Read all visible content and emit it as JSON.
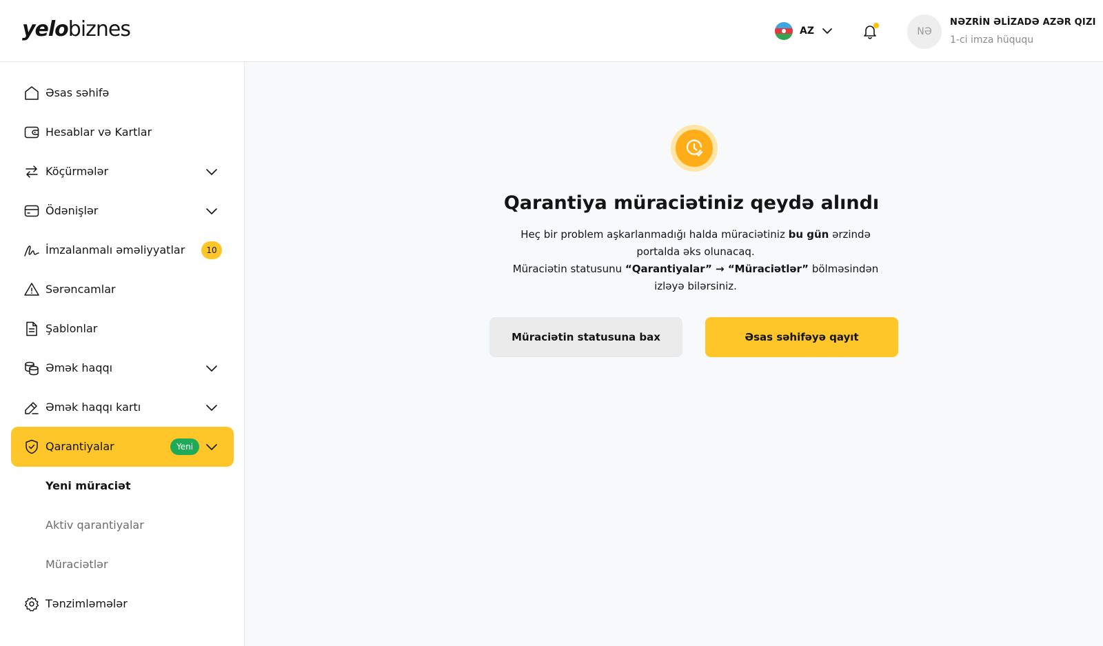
{
  "header": {
    "logo_bold": "yelo",
    "logo_light": "biznes",
    "language_code": "AZ",
    "user_initials": "NƏ",
    "user_name": "NƏZRİN ƏLİZADƏ AZƏR QIZI",
    "user_role": "1-ci imza hüququ"
  },
  "sidebar": {
    "items": [
      {
        "label": "Əsas səhifə",
        "icon": "home-icon"
      },
      {
        "label": "Hesablar və Kartlar",
        "icon": "wallet-icon"
      },
      {
        "label": "Köçürmələr",
        "icon": "transfer-icon",
        "expandable": true
      },
      {
        "label": "Ödənişlər",
        "icon": "card-icon",
        "expandable": true
      },
      {
        "label": "İmzalanmalı əməliyyatlar",
        "icon": "signature-icon",
        "badge": "10"
      },
      {
        "label": "Sərəncamlar",
        "icon": "warning-icon"
      },
      {
        "label": "Şablonlar",
        "icon": "document-icon"
      },
      {
        "label": "Əmək haqqı",
        "icon": "coins-icon",
        "expandable": true
      },
      {
        "label": "Əmək haqqı kartı",
        "icon": "edit-card-icon",
        "expandable": true
      },
      {
        "label": "Qarantiyalar",
        "icon": "shield-check-icon",
        "expandable": true,
        "active": true,
        "badge": "Yeni"
      },
      {
        "label": "Tənzimləmələr",
        "icon": "gear-icon"
      }
    ],
    "guarantee_subitems": [
      "Yeni müraciət",
      "Aktiv qarantiyalar",
      "Müraciətlər"
    ]
  },
  "main": {
    "title": "Qarantiya müraciətiniz qeydə alındı",
    "desc_part1": "Heç bir problem aşkarlanmadığı halda müraciətiniz ",
    "desc_bold1": "bu gün",
    "desc_part2": " ərzində portalda əks olunacaq.",
    "desc_part3": "Müraciətin statusunu ",
    "desc_bold2": "“Qarantiyalar” → “Müraciətlər”",
    "desc_part4": " bölməsindən izləyə bilərsiniz.",
    "secondary_button": "Müraciətin statusuna bax",
    "primary_button": "Əsas səhifəyə qayıt"
  },
  "colors": {
    "accent": "#ffc629",
    "success": "#1faa59",
    "status_icon": "#ffae1a"
  }
}
